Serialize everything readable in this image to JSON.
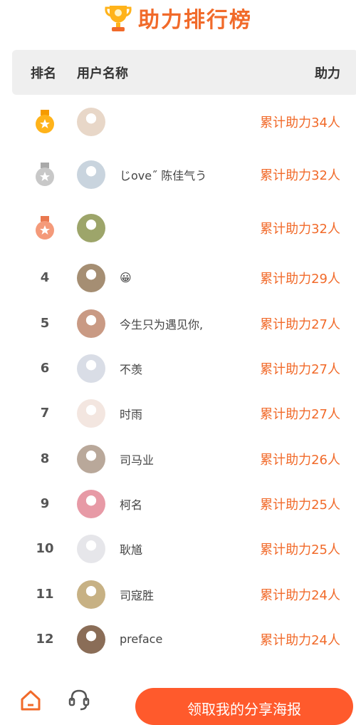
{
  "page": {
    "title": "助力排行榜"
  },
  "header": {
    "rank": "排名",
    "user": "用户名称",
    "help": "助力"
  },
  "rows": [
    {
      "rank": "",
      "medal": "gold",
      "name": "",
      "score": "累计助力34人",
      "avatar_color": "#e8d7c8"
    },
    {
      "rank": "",
      "medal": "silver",
      "name": "じove˝ 陈佳气う",
      "score": "累计助力32人",
      "avatar_color": "#c9d4de"
    },
    {
      "rank": "",
      "medal": "bronze",
      "name": "",
      "score": "累计助力32人",
      "avatar_color": "#9da56a"
    },
    {
      "rank": "4",
      "medal": "",
      "name": "😀",
      "score": "累计助力29人",
      "avatar_color": "#a58e73"
    },
    {
      "rank": "5",
      "medal": "",
      "name": "今生只为遇见你,",
      "score": "累计助力27人",
      "avatar_color": "#c99a84"
    },
    {
      "rank": "6",
      "medal": "",
      "name": "不羡",
      "score": "累计助力27人",
      "avatar_color": "#d9dde6"
    },
    {
      "rank": "7",
      "medal": "",
      "name": "时雨",
      "score": "累计助力27人",
      "avatar_color": "#f3e6e0"
    },
    {
      "rank": "8",
      "medal": "",
      "name": "司马业",
      "score": "累计助力26人",
      "avatar_color": "#b9a89a"
    },
    {
      "rank": "9",
      "medal": "",
      "name": "柯名",
      "score": "累计助力25人",
      "avatar_color": "#e79aa6"
    },
    {
      "rank": "10",
      "medal": "",
      "name": "耿馗",
      "score": "累计助力25人",
      "avatar_color": "#e6e6ea"
    },
    {
      "rank": "11",
      "medal": "",
      "name": "司寇胜",
      "score": "累计助力24人",
      "avatar_color": "#c7b184"
    },
    {
      "rank": "12",
      "medal": "",
      "name": "preface",
      "score": "累计助力24人",
      "avatar_color": "#8a6d57"
    }
  ],
  "bottom": {
    "poster_button": "领取我的分享海报"
  },
  "colors": {
    "accent": "#f16a2a",
    "button": "#ff5a2c",
    "header_bg": "#efefef"
  }
}
